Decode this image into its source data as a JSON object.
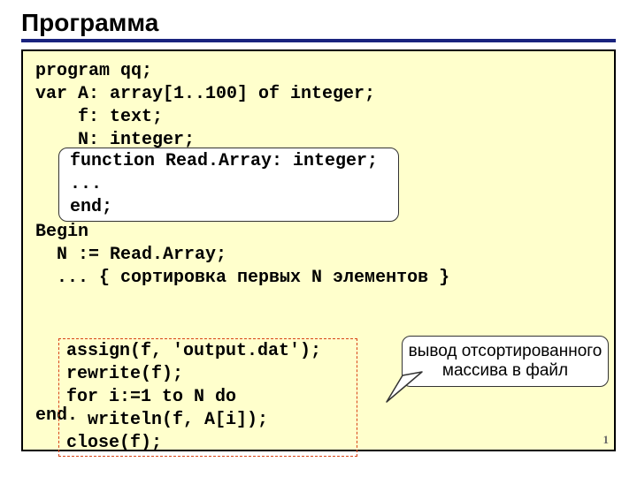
{
  "title": "Программа",
  "code_top": "program qq;\nvar A: array[1..100] of integer;\n    f: text;\n    N: integer;",
  "func_block": "function Read.Array: integer;\n...\nend;",
  "code_mid": "Begin\n  N := Read.Array;\n  ... { сортировка первых N элементов }",
  "output_block": "assign(f, 'output.dat');\nrewrite(f);\nfor i:=1 to N do\n  writeln(f, A[i]);\nclose(f);",
  "code_end": "end.",
  "callout": "вывод отсортированного массива в файл",
  "page_number": "1"
}
